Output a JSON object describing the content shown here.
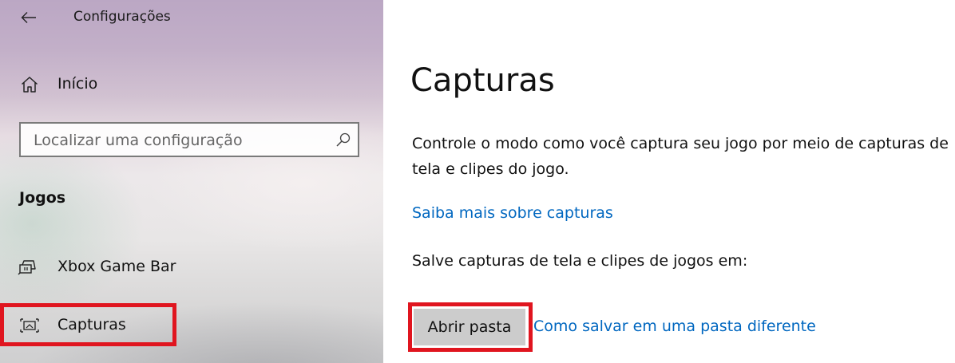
{
  "window": {
    "title": "Configurações"
  },
  "sidebar": {
    "home_label": "Início",
    "search": {
      "placeholder": "Localizar uma configuração"
    },
    "section_heading": "Jogos",
    "items": [
      {
        "label": "Xbox Game Bar",
        "icon": "xbox-game-bar-icon"
      },
      {
        "label": "Capturas",
        "icon": "captures-icon",
        "highlighted": true
      }
    ]
  },
  "main": {
    "title": "Capturas",
    "description_line1": "Controle o modo como você captura seu jogo por meio de capturas de",
    "description_line2": "tela e clipes do jogo.",
    "learn_more_link": "Saiba mais sobre capturas",
    "save_location_text": "Salve capturas de tela e clipes de jogos em:",
    "open_folder_button": "Abrir pasta",
    "how_to_link": "Como salvar em uma pasta diferente"
  },
  "colors": {
    "link": "#0067c0",
    "highlight_box": "#e0151f",
    "button_bg": "#cccccc"
  }
}
